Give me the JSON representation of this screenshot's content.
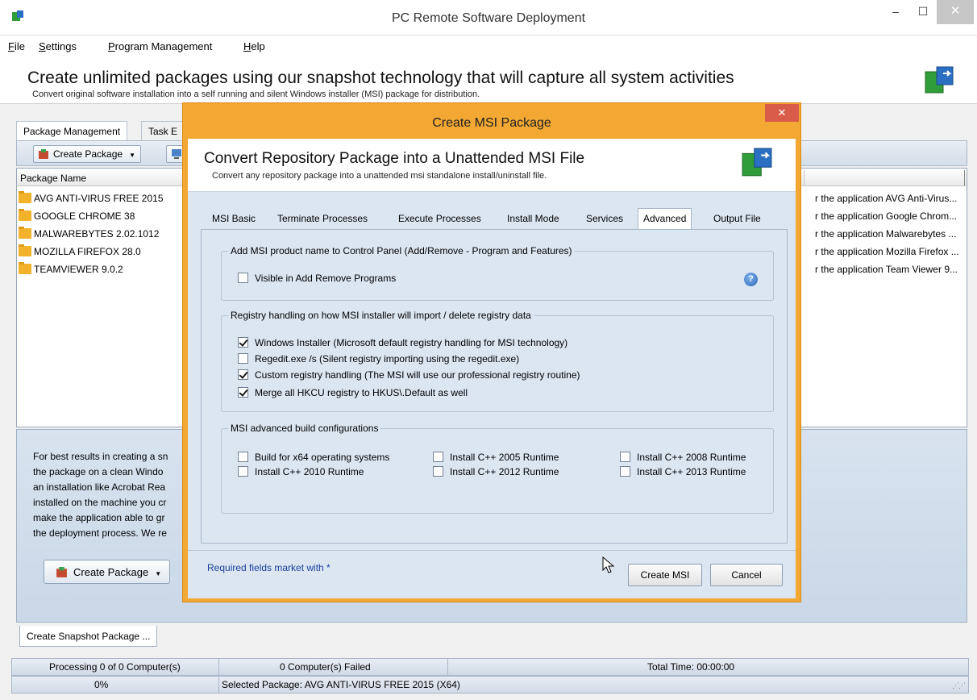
{
  "window": {
    "title": "PC Remote Software Deployment",
    "minimize": "–",
    "maximize": "☐",
    "close": "✕"
  },
  "menu": [
    {
      "accel": "F",
      "rest": "ile"
    },
    {
      "accel": "S",
      "rest": "ettings"
    },
    {
      "accel": "P",
      "rest": "rogram Management"
    },
    {
      "accel": "H",
      "rest": "elp"
    }
  ],
  "banner": {
    "title": "Create unlimited packages using our snapshot technology that will capture all system activities",
    "subtitle": "Convert original software installation into a self running and silent Windows installer (MSI) package for distribution."
  },
  "tabs": [
    "Package Management",
    "Task E"
  ],
  "toolbar": {
    "create_package": "Create Package"
  },
  "list": {
    "column_package_name": "Package Name",
    "rows": [
      {
        "name": "AVG ANTI-VIRUS FREE 2015",
        "desc": "r the application AVG Anti-Virus..."
      },
      {
        "name": "GOOGLE CHROME 38",
        "desc": "r the application Google Chrom..."
      },
      {
        "name": "MALWAREBYTES 2.02.1012",
        "desc": "r the application Malwarebytes ..."
      },
      {
        "name": "MOZILLA FIREFOX 28.0",
        "desc": "r the application Mozilla Firefox ..."
      },
      {
        "name": "TEAMVIEWER 9.0.2",
        "desc": "r the application Team Viewer 9..."
      }
    ]
  },
  "info": {
    "lines": [
      "For best results in creating a sn",
      "the package on a clean Windo",
      "an installation like Acrobat Rea",
      "installed on the machine you cr",
      "make the application able to gr",
      "the deployment process. We re"
    ],
    "create_package": "Create Package"
  },
  "bottom_tab": "Create Snapshot Package ...",
  "status": {
    "processing": "Processing 0 of 0 Computer(s)",
    "failed": "0 Computer(s) Failed",
    "total_time": "Total Time: 00:00:00",
    "progress": "0%",
    "progress_fraction": 0,
    "selected": "Selected Package: AVG ANTI-VIRUS FREE 2015 (X64)"
  },
  "dialog": {
    "title": "Create MSI Package",
    "close": "✕",
    "heading": "Convert Repository Package into a Unattended MSI File",
    "subheading": "Convert any repository package into a unattended msi standalone install/uninstall file.",
    "tabs": [
      "MSI Basic",
      "Terminate Processes",
      "Execute Processes",
      "Install Mode",
      "Services",
      "Advanced",
      "Output File"
    ],
    "active_tab": "Advanced",
    "group1": {
      "label": "Add MSI product name to Control Panel (Add/Remove - Program and Features)",
      "items": [
        {
          "label": "Visible in Add Remove Programs",
          "checked": false
        }
      ]
    },
    "group2": {
      "label": "Registry handling on how MSI installer will import / delete registry data",
      "items": [
        {
          "label": "Windows Installer (Microsoft default registry handling for MSI technology)",
          "checked": true
        },
        {
          "label": "Regedit.exe /s (Silent registry importing using the regedit.exe)",
          "checked": false
        },
        {
          "label": "Custom registry handling (The MSI will use our professional registry routine)",
          "checked": true
        },
        {
          "label": "Merge all HKCU registry to HKUS\\.Default as well",
          "checked": true
        }
      ]
    },
    "group3": {
      "label": "MSI advanced build configurations",
      "items": [
        {
          "label": "Build for x64 operating systems",
          "checked": false
        },
        {
          "label": "Install C++ 2005 Runtime",
          "checked": false
        },
        {
          "label": "Install C++ 2008 Runtime",
          "checked": false
        },
        {
          "label": "Install C++ 2010 Runtime",
          "checked": false
        },
        {
          "label": "Install C++ 2012 Runtime",
          "checked": false
        },
        {
          "label": "Install C++ 2013 Runtime",
          "checked": false
        }
      ]
    },
    "help": "?",
    "required_note": "Required fields market with *",
    "create_msi": "Create MSI",
    "cancel": "Cancel"
  }
}
